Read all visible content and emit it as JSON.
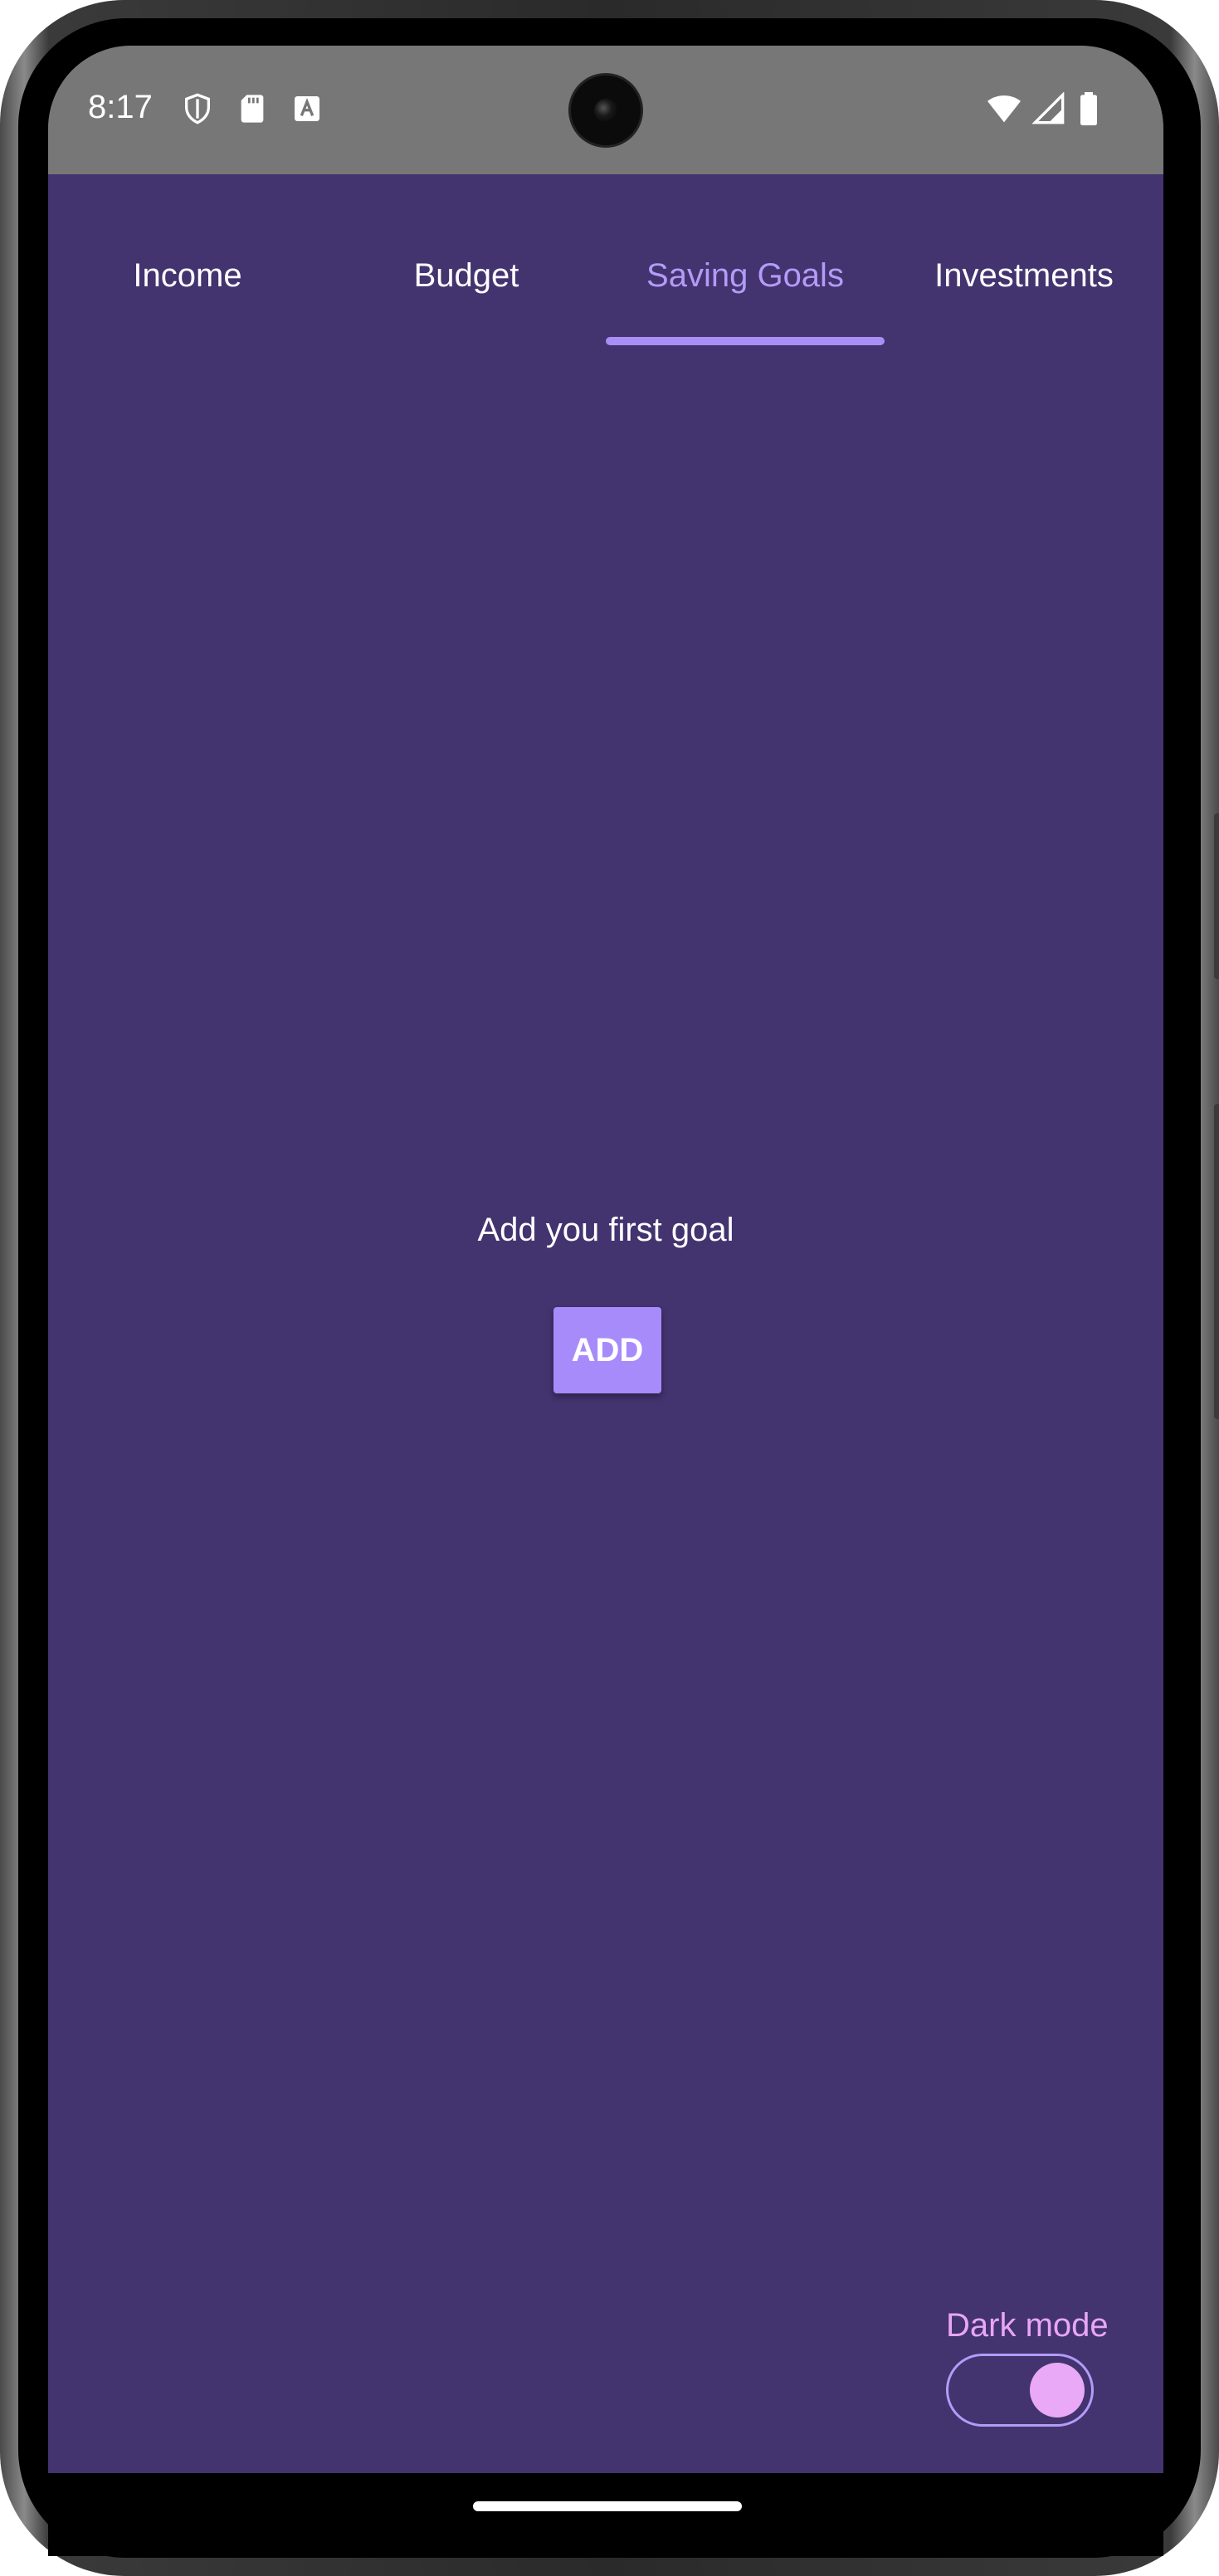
{
  "status_bar": {
    "time": "8:17",
    "left_icons": [
      "shield-icon",
      "sd-card-icon",
      "font-a-icon"
    ],
    "right_icons": [
      "wifi-icon",
      "cell-signal-icon",
      "battery-icon"
    ]
  },
  "tabs": [
    {
      "label": "Income",
      "active": false
    },
    {
      "label": "Budget",
      "active": false
    },
    {
      "label": "Saving Goals",
      "active": true
    },
    {
      "label": "Investments",
      "active": false
    }
  ],
  "main": {
    "empty_message": "Add you first goal",
    "add_button_label": "ADD"
  },
  "settings": {
    "dark_mode_label": "Dark mode",
    "dark_mode_enabled": true
  },
  "colors": {
    "background": "#43336f",
    "status_bar": "#777777",
    "accent": "#a78bfa",
    "active_tab": "#b39bf7",
    "toggle_accent": "#e9a9f6"
  }
}
